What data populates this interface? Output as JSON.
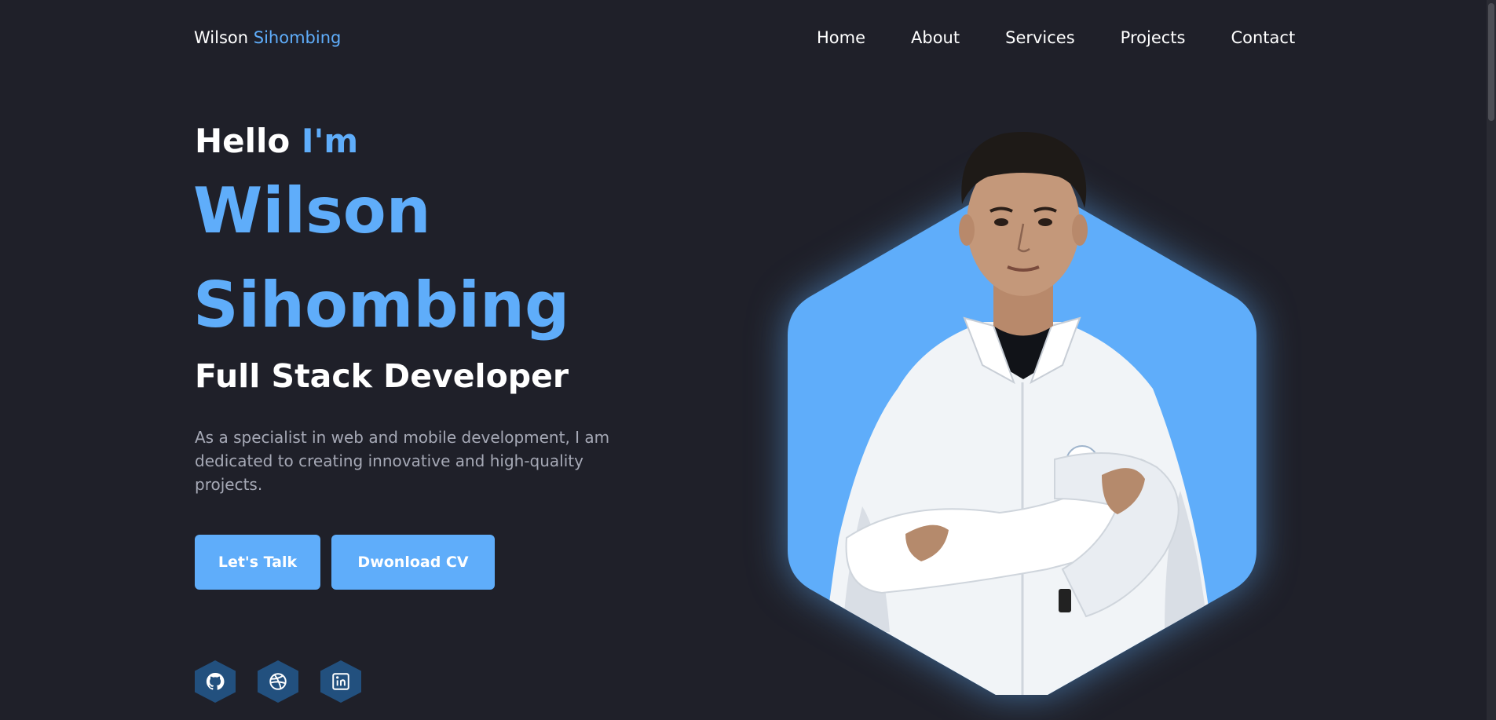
{
  "header": {
    "logo_first": "Wilson",
    "logo_second": "Sihombing",
    "nav": [
      "Home",
      "About",
      "Services",
      "Projects",
      "Contact"
    ]
  },
  "hero": {
    "hello": "Hello",
    "im": "I'm",
    "name_first": "Wilson",
    "name_last": "Sihombing",
    "role": "Full Stack Developer",
    "description": "As a specialist in web and mobile development, I am dedicated to creating innovative and high-quality projects.",
    "btn_talk": "Let's Talk",
    "btn_cv": "Dwonload CV"
  },
  "social": [
    {
      "icon": "github-icon"
    },
    {
      "icon": "dribbble-icon"
    },
    {
      "icon": "linkedin-icon"
    }
  ],
  "colors": {
    "background": "#1f2029",
    "accent": "#5fadfa",
    "text": "#ffffff",
    "muted": "#a6a9b6",
    "social_bg": "#22507e"
  }
}
